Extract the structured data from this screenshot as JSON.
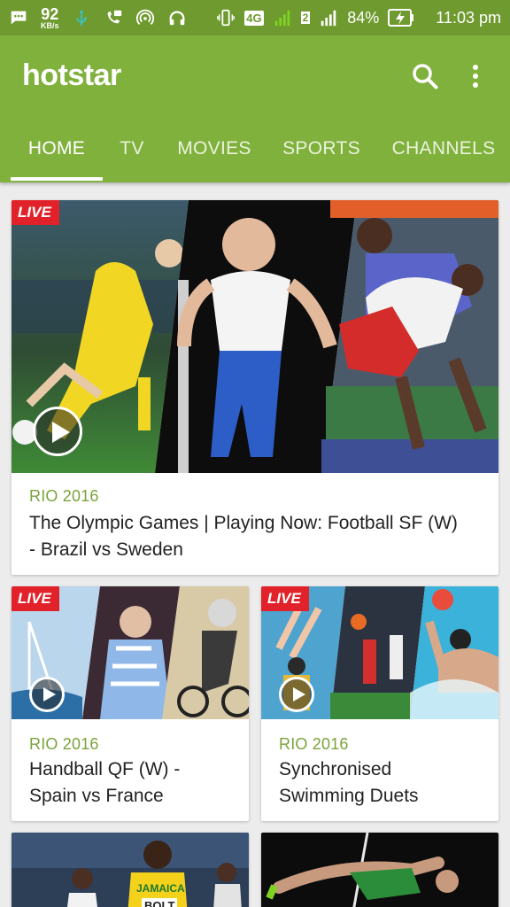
{
  "status_bar": {
    "speed": "92",
    "speed_unit": "KB/s",
    "network": "4G",
    "sim": "2",
    "battery": "84%",
    "time": "11:03 pm"
  },
  "app": {
    "logo": "hotstar",
    "brand_color": "#80b13d"
  },
  "tabs": [
    {
      "label": "HOME"
    },
    {
      "label": "TV"
    },
    {
      "label": "MOVIES"
    },
    {
      "label": "SPORTS"
    },
    {
      "label": "CHANNELS"
    }
  ],
  "cards": [
    {
      "badge": "LIVE",
      "tag": "RIO 2016",
      "title_line1": "The Olympic Games | Playing Now: Football SF (W)",
      "title_line2": "- Brazil vs Sweden"
    },
    {
      "badge": "LIVE",
      "tag": "RIO 2016",
      "title_line1": "Handball QF (W) -",
      "title_line2": "Spain vs France"
    },
    {
      "badge": "LIVE",
      "tag": "RIO 2016",
      "title_line1": "Synchronised",
      "title_line2": "Swimming Duets"
    },
    {
      "thumb_text": "JAMAICA",
      "thumb_text2": "BOLT"
    },
    {}
  ]
}
